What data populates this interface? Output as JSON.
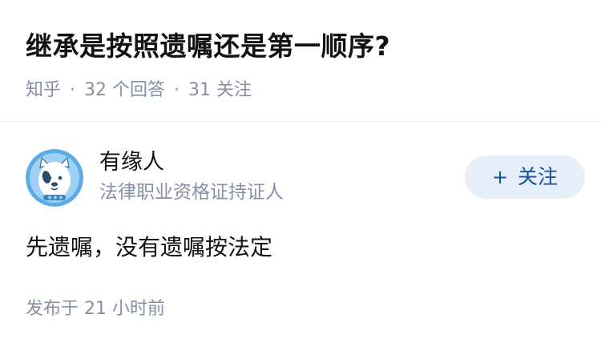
{
  "question": {
    "title": "继承是按照遗嘱还是第一顺序?",
    "source": "知乎",
    "separator": "·",
    "answer_count": "32 个回答",
    "follower_count": "31 关注"
  },
  "answer": {
    "author": {
      "name": "有缘人",
      "headline": "法律职业资格证持证人",
      "avatar_icon": "dog-avatar-icon"
    },
    "follow_button": {
      "icon": "+",
      "label": "关注"
    },
    "content": "先遗嘱，没有遗嘱按法定",
    "publish_time": "发布于 21 小时前"
  },
  "colors": {
    "primary_text": "#121212",
    "secondary_text": "#8590a6",
    "follow_bg": "#e6eefa",
    "follow_text": "#175199",
    "avatar_bg": "#5dabe4"
  }
}
